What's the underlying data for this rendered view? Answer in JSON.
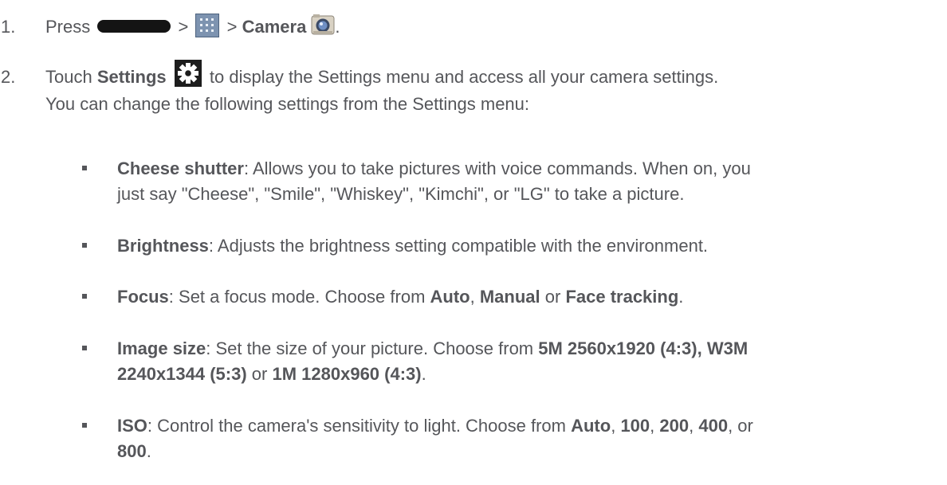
{
  "steps": [
    {
      "number": "1.",
      "parts": {
        "press": "Press",
        "sep1": ">",
        "sep2": ">",
        "camera": "Camera",
        "end": "."
      }
    },
    {
      "number": "2.",
      "parts": {
        "touch": "Touch",
        "settings": "Settings",
        "rest1": "to display the Settings menu and access all your camera settings.",
        "line2": "You can change the following settings from the Settings menu:"
      }
    }
  ],
  "bullets": [
    {
      "term": "Cheese shutter",
      "line1_rest": ": Allows you to take pictures with voice commands. When on, you",
      "line2": "just say \"Cheese\", \"Smile\", \"Whiskey\", \"Kimchi\", or \"LG\" to take a picture."
    },
    {
      "term": "Brightness",
      "rest": ": Adjusts the brightness setting compatible with the environment."
    },
    {
      "term": "Focus",
      "rest": ": Set a focus mode. Choose from ",
      "opt1": "Auto",
      "sep1": ", ",
      "opt2": "Manual",
      "sep2": " or ",
      "opt3": "Face tracking",
      "end": "."
    },
    {
      "term": "Image size",
      "rest": ": Set the size of your picture. Choose from ",
      "opt1": "5M 2560x1920 (4:3), W3M",
      "opt1b": "2240x1344 (5:3)",
      "sep": " or ",
      "opt2": "1M 1280x960 (4:3)",
      "end": "."
    },
    {
      "term": "ISO",
      "rest": ": Control the camera's sensitivity to light. Choose from ",
      "opt1": "Auto",
      "s1": ", ",
      "opt2": "100",
      "s2": ", ",
      "opt3": "200",
      "s3": ", ",
      "opt4": "400",
      "s4": ", or",
      "opt5": "800",
      "end": "."
    }
  ],
  "icons": {
    "home_key": "home-key-icon",
    "apps": "apps-grid-icon",
    "camera": "camera-app-icon",
    "settings": "gear-icon"
  }
}
